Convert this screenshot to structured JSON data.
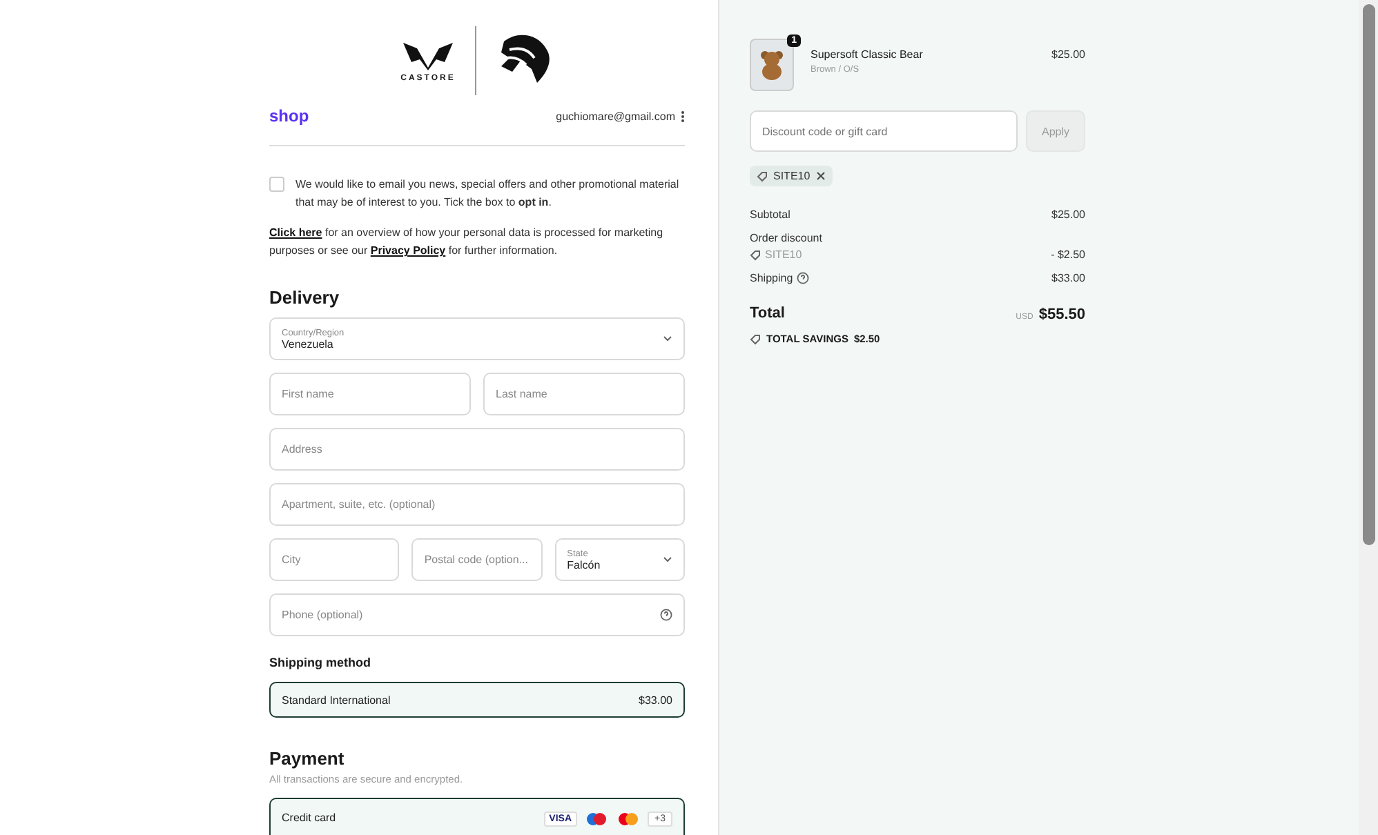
{
  "brand": {
    "wordmark": "CASTORE"
  },
  "account": {
    "logo": "shop",
    "email": "guchiomare@gmail.com"
  },
  "marketing_optin": {
    "checked": false,
    "text": "We would like to email you news, special offers and other promotional material that may be of interest to you. Tick the box to **opt in**."
  },
  "privacy": {
    "link_1": "Click here",
    "text_1": " for an overview of how your personal data is processed for marketing purposes or see our ",
    "link_2": "Privacy Policy",
    "text_2": " for further information."
  },
  "delivery": {
    "title": "Delivery",
    "fields": [
      {
        "kind": "select",
        "label": "Country/Region",
        "value": "Venezuela"
      },
      {
        "kind": "pair",
        "items": [
          {
            "placeholder": "First name"
          },
          {
            "placeholder": "Last name"
          }
        ]
      },
      {
        "kind": "text",
        "placeholder": "Address"
      },
      {
        "kind": "text",
        "placeholder": "Apartment, suite, etc. (optional)"
      },
      {
        "kind": "triple",
        "items": [
          {
            "placeholder": "City"
          },
          {
            "placeholder": "Postal code (option..."
          }
        ],
        "select": {
          "label": "State",
          "value": "Falcón"
        }
      },
      {
        "kind": "help",
        "placeholder": "Phone (optional)"
      }
    ]
  },
  "shipping_method": {
    "title": "Shipping method",
    "options": [
      {
        "label": "Standard International",
        "price": "$33.00",
        "selected": true
      }
    ]
  },
  "payment": {
    "title": "Payment",
    "subtitle": "All transactions are secure and encrypted.",
    "methods": [
      {
        "label": "Credit card",
        "selected": true,
        "cards": [
          "VISA"
        ],
        "more": "+3"
      }
    ]
  },
  "cart": {
    "items": [
      {
        "quantity": "1",
        "name": "Supersoft Classic Bear",
        "variant": "Brown / O/S",
        "price": "$25.00"
      }
    ],
    "discount": {
      "placeholder": "Discount code or gift card",
      "button": "Apply",
      "applied": [
        "SITE10"
      ]
    },
    "lines": [
      {
        "kind": "plain",
        "label": "Subtotal",
        "value": "$25.00"
      },
      {
        "kind": "discount",
        "label": "Order discount",
        "code": "SITE10",
        "value": "- $2.50"
      },
      {
        "kind": "help",
        "label": "Shipping",
        "value": "$33.00"
      }
    ],
    "total": {
      "label": "Total",
      "currency": "USD",
      "value": "$55.50"
    },
    "savings": {
      "label": "TOTAL SAVINGS",
      "value": "$2.50"
    }
  }
}
